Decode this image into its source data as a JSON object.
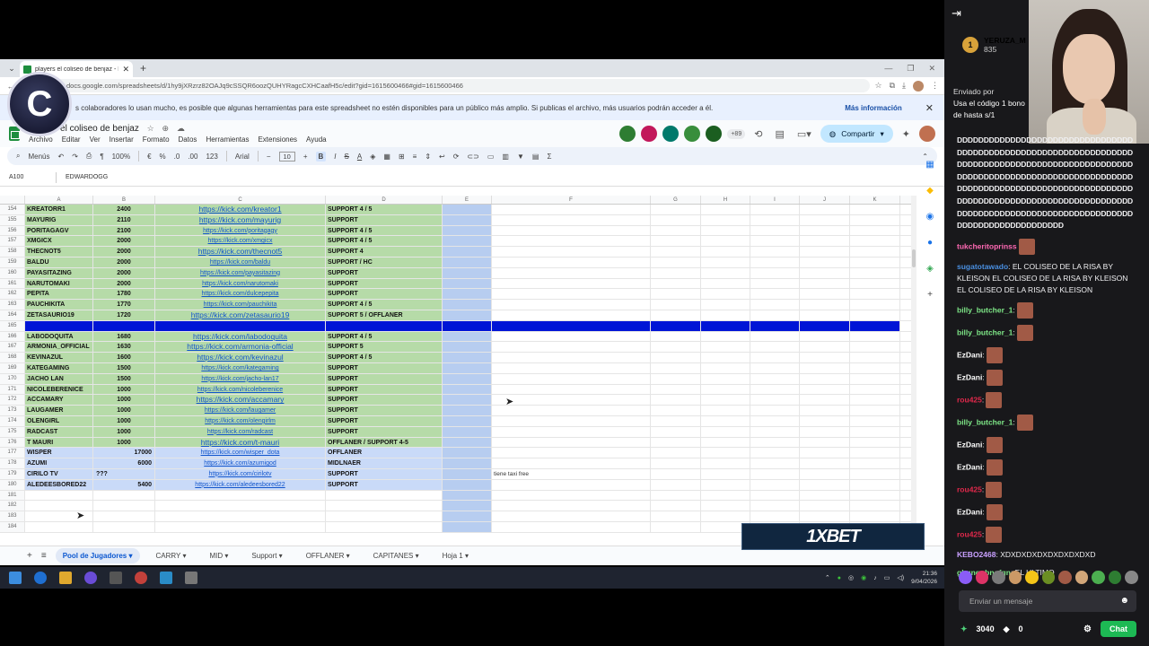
{
  "browser": {
    "tab_title": "players el coliseo de benjaz - Hoja",
    "url": "docs.google.com/spreadsheets/d/1hy9jXRzrz82OAJq9cSSQR6oozQUHYRagcCXHCaafH5c/edit?gid=1615600466#gid=1615600466"
  },
  "notice": {
    "text": "s colaboradores lo usan mucho, es posible que algunas herramientas para este spreadsheet no estén disponibles para un público más amplio. Si publicas el archivo, más usuarios podrán acceder a él.",
    "link": "Más información"
  },
  "doc": {
    "title": "players el coliseo de benjaz",
    "menus": [
      "Archivo",
      "Editar",
      "Ver",
      "Insertar",
      "Formato",
      "Datos",
      "Herramientas",
      "Extensiones",
      "Ayuda"
    ],
    "ext_count": "+89",
    "share_label": "Compartir"
  },
  "toolbar": {
    "menus_label": "Menús",
    "zoom": "100%",
    "currency": "€",
    "percent": "%",
    "format123": "123",
    "font": "Arial",
    "font_size": "10",
    "bold": "B",
    "italic": "I",
    "strike": "S",
    "textcolor": "A"
  },
  "formula_bar": {
    "cell_ref": "A100",
    "value": "EDWARDOGG"
  },
  "columns": [
    "A",
    "B",
    "C",
    "D",
    "E",
    "F",
    "G",
    "H",
    "I",
    "J",
    "K"
  ],
  "rows": [
    {
      "n": "154",
      "a": "KREATORR1",
      "b": "2400",
      "c": "https://kick.com/kreator1",
      "d": "SUPPORT 4 / 5",
      "f": "",
      "style": "green",
      "big": true
    },
    {
      "n": "155",
      "a": "MAYURIG",
      "b": "2110",
      "c": "https://kick.com/mayurig",
      "d": "SUPPORT",
      "f": "",
      "style": "green",
      "big": true
    },
    {
      "n": "156",
      "a": "PORITAGAGV",
      "b": "2100",
      "c": "https://kick.com/poritagagy",
      "d": "SUPPORT 4 / 5",
      "f": "",
      "style": "green",
      "big": false
    },
    {
      "n": "157",
      "a": "XMGICX",
      "b": "2000",
      "c": "https://kick.com/xmgicx",
      "d": "SUPPORT 4 / 5",
      "f": "",
      "style": "green",
      "big": false
    },
    {
      "n": "158",
      "a": "THECNOT5",
      "b": "2000",
      "c": "https://kick.com/thecnot5",
      "d": "SUPPORT 4",
      "f": "",
      "style": "green",
      "big": true
    },
    {
      "n": "159",
      "a": "BALDU",
      "b": "2000",
      "c": "https://kick.com/baldu",
      "d": "SUPPORT / HC",
      "f": "",
      "style": "green",
      "big": false
    },
    {
      "n": "160",
      "a": "PAYASITAZING",
      "b": "2000",
      "c": "https://kick.com/payasitazing",
      "d": "SUPPORT",
      "f": "",
      "style": "green",
      "big": false
    },
    {
      "n": "161",
      "a": "NARUTOMAKI",
      "b": "2000",
      "c": "https://kick.com/narutomaki",
      "d": "SUPPORT",
      "f": "",
      "style": "green",
      "big": false
    },
    {
      "n": "162",
      "a": "PEPITA",
      "b": "1780",
      "c": "https://kick.com/dulcepepita",
      "d": "SUPPORT",
      "f": "",
      "style": "green",
      "big": false
    },
    {
      "n": "163",
      "a": "PAUCHIKITA",
      "b": "1770",
      "c": "https://kick.com/pauchikita",
      "d": "SUPPORT 4 / 5",
      "f": "",
      "style": "green",
      "big": false
    },
    {
      "n": "164",
      "a": "ZETASAURIO19",
      "b": "1720",
      "c": "https://kick.com/zetasaurio19",
      "d": "SUPPORT 5 / OFFLANER",
      "f": "",
      "style": "green",
      "big": true
    },
    {
      "n": "165",
      "a": "",
      "b": "",
      "c": "",
      "d": "",
      "f": "",
      "style": "highlight",
      "big": false
    },
    {
      "n": "166",
      "a": "LABODOQUITA",
      "b": "1680",
      "c": "https://kick.com/labodoquita",
      "d": "SUPPORT 4 / 5",
      "f": "",
      "style": "green",
      "big": true
    },
    {
      "n": "167",
      "a": "ARMONIA_OFFICIAL",
      "b": "1630",
      "c": "https://kick.com/armonia-official",
      "d": "SUPPORT 5",
      "f": "",
      "style": "green",
      "big": true
    },
    {
      "n": "168",
      "a": "KEVINAZUL",
      "b": "1600",
      "c": "https://kick.com/kevinazul",
      "d": "SUPPORT 4 / 5",
      "f": "",
      "style": "green",
      "big": true
    },
    {
      "n": "169",
      "a": "KATEGAMING",
      "b": "1500",
      "c": "https://kick.com/kategaming",
      "d": "SUPPORT",
      "f": "",
      "style": "green",
      "big": false
    },
    {
      "n": "170",
      "a": "JACHO LAN",
      "b": "1500",
      "c": "https://kick.com/jacho-lan17",
      "d": "SUPPORT",
      "f": "",
      "style": "green",
      "big": false
    },
    {
      "n": "171",
      "a": "NICOLEBERENICE",
      "b": "1000",
      "c": "https://kick.com/nicoleberenice",
      "d": "SUPPORT",
      "f": "",
      "style": "green",
      "big": false
    },
    {
      "n": "172",
      "a": "ACCAMARY",
      "b": "1000",
      "c": "https://kick.com/accamary",
      "d": "SUPPORT",
      "f": "",
      "style": "green",
      "big": true
    },
    {
      "n": "173",
      "a": "LAUGAMER",
      "b": "1000",
      "c": "https://kick.com/laugamer",
      "d": "SUPPORT",
      "f": "",
      "style": "green",
      "big": false
    },
    {
      "n": "174",
      "a": "OLENGIRL",
      "b": "1000",
      "c": "https://kick.com/olengirlm",
      "d": "SUPPORT",
      "f": "",
      "style": "green",
      "big": false
    },
    {
      "n": "175",
      "a": "RADCAST",
      "b": "1000",
      "c": "https://kick.com/radcast",
      "d": "SUPPORT",
      "f": "",
      "style": "green",
      "big": false
    },
    {
      "n": "176",
      "a": "T MAURI",
      "b": "1000",
      "c": "https://kick.com/t-mauri",
      "d": "OFFLANER / SUPPORT 4-5",
      "f": "",
      "style": "green",
      "big": true
    },
    {
      "n": "177",
      "a": "WISPER",
      "b": "17000",
      "c": "https://kick.com/wisper_dota",
      "d": "OFFLANER",
      "f": "",
      "style": "blue",
      "big": false
    },
    {
      "n": "178",
      "a": "AZUMI",
      "b": "6000",
      "c": "https://kick.com/azumigod",
      "d": "MIDLNAER",
      "f": "",
      "style": "blue",
      "big": false
    },
    {
      "n": "179",
      "a": "CIRILO TV",
      "b": "???",
      "c": "https://kick.com/cirilotv",
      "d": "SUPPORT",
      "f": "tiene taxi free",
      "style": "blue left-b",
      "big": false
    },
    {
      "n": "180",
      "a": "ALEDEESBORED22",
      "b": "5400",
      "c": "https://kick.com/aledeesbored22",
      "d": "SUPPORT",
      "f": "",
      "style": "blue",
      "big": false
    },
    {
      "n": "181",
      "a": "",
      "b": "",
      "c": "",
      "d": "",
      "f": "",
      "style": "empty",
      "big": false
    },
    {
      "n": "182",
      "a": "",
      "b": "",
      "c": "",
      "d": "",
      "f": "",
      "style": "empty",
      "big": false
    },
    {
      "n": "183",
      "a": "",
      "b": "",
      "c": "",
      "d": "",
      "f": "",
      "style": "empty",
      "big": false
    },
    {
      "n": "184",
      "a": "",
      "b": "",
      "c": "",
      "d": "",
      "f": "",
      "style": "empty",
      "big": false
    }
  ],
  "sheet_tabs": [
    "Pool de Jugadores",
    "CARRY",
    "MID",
    "Support",
    "OFFLANER",
    "CAPITANES",
    "Hoja 1"
  ],
  "ad_text": "1XBET",
  "taskbar": {
    "time": "21:36",
    "date": "9/04/2026"
  },
  "channel_logo": "C",
  "chat": {
    "pinned_user": "YERUZA_M",
    "pinned_count": "835",
    "pinned_rank": "1",
    "sent_by": "Enviado por",
    "promo_text": "Usa el código 1 bono de hasta s/1",
    "d_wall": "DDDDDDDDDDDDDDDDDDDDDDDDDDDDDDDDDDDDDDDDDDDDDDDDDDDDDDDDDDDDDDDDDDDDDDDDDDDDDDDDDDDDDDDDDDDDDDDDDDDDDDDDDDDDDDDDDDDDDDDDDDDDDDDDDDDDDDDDDDDDDDDDDDDDDDDDDDDDDDDDDDDDDDDDDDDDDDDDDDDDDDDDDDDDDDDDDDDDDDDDDDDDDDDDDDDDDDDDDDDDDDDDDDDDDDDDDDDDDDDDDDDDDDDDDDD",
    "messages": [
      {
        "user": "tukcheritoprinss",
        "color": "#ff69b4",
        "text": "",
        "emote": true
      },
      {
        "user": "sugatotawado",
        "color": "#4a90e2",
        "text": ": EL COLISEO DE LA RISA BY KLEISON EL COLISEO DE LA RISA BY KLEISON EL COLISEO DE LA RISA BY KLEISON",
        "emote": false
      },
      {
        "user": "billy_butcher_1",
        "color": "#7ee787",
        "text": ":",
        "emote": true
      },
      {
        "user": "billy_butcher_1",
        "color": "#7ee787",
        "text": ":",
        "emote": true
      },
      {
        "user": "EzDani",
        "color": "#ffffff",
        "text": ":",
        "emote": true
      },
      {
        "user": "EzDani",
        "color": "#ffffff",
        "text": ":",
        "emote": true
      },
      {
        "user": "rou425",
        "color": "#e0284b",
        "text": ":",
        "emote": true
      },
      {
        "user": "billy_butcher_1",
        "color": "#7ee787",
        "text": ":",
        "emote": true
      },
      {
        "user": "EzDani",
        "color": "#ffffff",
        "text": ":",
        "emote": true
      },
      {
        "user": "EzDani",
        "color": "#ffffff",
        "text": ":",
        "emote": true
      },
      {
        "user": "rou425",
        "color": "#e0284b",
        "text": ":",
        "emote": true
      },
      {
        "user": "EzDani",
        "color": "#ffffff",
        "text": ":",
        "emote": true
      },
      {
        "user": "rou425",
        "color": "#e0284b",
        "text": ":",
        "emote": true
      },
      {
        "user": "KEBO2468",
        "color": "#c9a0ff",
        "text": ": XDXDXDXDXDXDXDXDXD",
        "emote": false
      },
      {
        "user": "gbgnggbngfgn",
        "color": "#7ee787",
        "text": ": EL ULTIMO",
        "emote": false
      }
    ],
    "input_placeholder": "Enviar un mensaje",
    "points": "3040",
    "bits": "0",
    "chat_button": "Chat"
  }
}
